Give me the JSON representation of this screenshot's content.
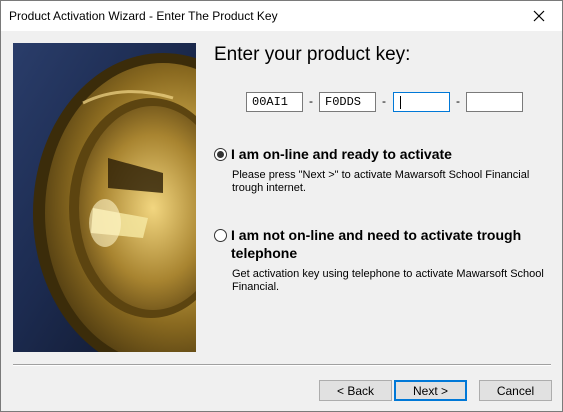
{
  "window": {
    "title": "Product Activation Wizard - Enter The Product Key"
  },
  "heading": "Enter your product key:",
  "product_key": {
    "fields": [
      "00AI1",
      "F0DDS",
      "",
      ""
    ],
    "separator": "-"
  },
  "options": [
    {
      "label": "I am on-line and ready to activate",
      "description_line1": "Please press \"Next >\" to activate Mawarsoft School Financial",
      "description_line2": "trough internet.",
      "selected": true
    },
    {
      "label_line1": "I am not on-line and need to activate trough",
      "label_line2": "telephone",
      "description_line1": "Get activation key using telephone to activate Mawarsoft School",
      "description_line2": "Financial.",
      "selected": false
    }
  ],
  "buttons": {
    "back": "< Back",
    "next": "Next >",
    "cancel": "Cancel"
  },
  "icons": {
    "close": "close-icon",
    "image": "gold-lock-cylinder-photo"
  },
  "colors": {
    "focus_blue": "#0078d7",
    "window_bg": "#f0f0f0",
    "titlebar_bg": "#ffffff"
  }
}
